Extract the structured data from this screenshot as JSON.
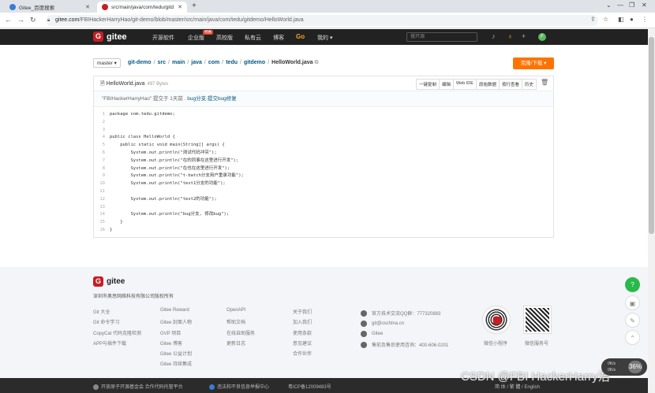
{
  "browser": {
    "tabs": [
      {
        "title": "Gitee_百度搜索",
        "active": false
      },
      {
        "title": "src/main/java/com/tedu/gitd",
        "active": true
      }
    ],
    "url_host": "gitee.com",
    "url_path": "/FBIHackerHarryHao/git-demo/blob/master/src/main/java/com/tedu/gitdemo/HelloWorld.java"
  },
  "header": {
    "logo": "gitee",
    "nav": [
      "开源软件",
      "企业版",
      "高校版",
      "私有云",
      "博客"
    ],
    "go": "Go",
    "mine": "我的 ▾",
    "new_tag": "特惠",
    "search_placeholder": "搜开源"
  },
  "repo": {
    "branch": "master ▾",
    "breadcrumbs": [
      "git-demo",
      "src",
      "main",
      "java",
      "com",
      "tedu",
      "gitdemo"
    ],
    "filename": "HelloWorld.java",
    "clone_label": "克隆/下载 ▾"
  },
  "file": {
    "name": "HelloWorld.java",
    "size": "497 Bytes",
    "buttons": [
      "一键复制",
      "编辑",
      "Web IDE",
      "原始数据",
      "按行查看",
      "历史"
    ],
    "commit_author": "\"FBIHackerHarryHao\"",
    "commit_time": " 提交于 1天前 . ",
    "commit_msg": "bug分支:提交bug修复"
  },
  "code_lines": [
    "package com.tedu.gitdemo;",
    "",
    "",
    "public class HelloWorld {",
    "    public static void main(String[] args) {",
    "        System.out.println(\"测试代码冲突\");",
    "        System.out.println(\"在的同事在这里进行开发\");",
    "        System.out.println(\"在也在这里进行开发\");",
    "        System.out.println(\"t-batch分支用户重录功能\");",
    "        System.out.println(\"test1分支的功能\");",
    "",
    "        System.out.println(\"test2的功能\");",
    "",
    "        System.out.println(\"bug分支, 修改bug\");",
    "    }",
    "}"
  ],
  "footer": {
    "logo": "gitee",
    "copyright": "深圳市奥思网络科技有限公司版权所有",
    "col1": [
      "Git 大全",
      "Git 命令学习",
      "CopyCat 代码克隆检测",
      "APP与插件下载"
    ],
    "col2": [
      "Gitee Reward",
      "Gitee 封面人物",
      "GVP 项目",
      "Gitee 博客",
      "Gitee 公益计划",
      "Gitee 持续集成"
    ],
    "col3": [
      "OpenAPI",
      "帮助文档",
      "在线自助服务",
      "更新日志"
    ],
    "col4": [
      "关于我们",
      "加入我们",
      "使用条款",
      "意见建议",
      "合作伙伴"
    ],
    "contact": [
      "官方技术交流QQ群：777320883",
      "git@oschina.cn",
      "Gitee",
      "售前及售后使用咨询：400-606-0201"
    ],
    "qr_labels": [
      "微信小程序",
      "微信服务号"
    ],
    "bottom": [
      "开放原子开源基金会  合作代码托管平台",
      "违法和不良信息举报中心",
      "粤ICP备12009483号",
      "简 体 / 繁 體 / English"
    ]
  },
  "overlay": {
    "watermark": "CSDN @FBI HackerHarry浩",
    "widget_pct": "36%",
    "widget_up": "0K/s",
    "widget_down": "0K/s"
  },
  "colors": {
    "gitee_red": "#c71d23",
    "clone_orange": "#fe7300",
    "header_dark": "#222222",
    "link_blue": "#005980"
  }
}
